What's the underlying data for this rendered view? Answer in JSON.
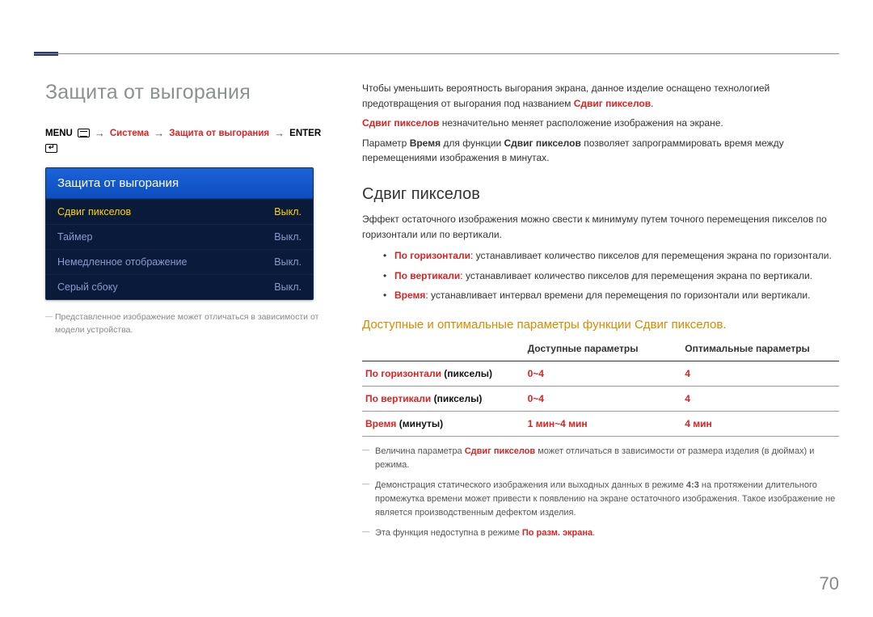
{
  "header": {
    "title": "Защита от выгорания"
  },
  "breadcrumb": {
    "menu": "MENU",
    "system": "Система",
    "protection": "Защита от выгорания",
    "enter": "ENTER"
  },
  "osd": {
    "title": "Защита от выгорания",
    "rows": [
      {
        "label": "Сдвиг пикселов",
        "value": "Выкл."
      },
      {
        "label": "Таймер",
        "value": "Выкл."
      },
      {
        "label": "Немедленное отображение",
        "value": "Выкл."
      },
      {
        "label": "Серый сбоку",
        "value": "Выкл."
      }
    ]
  },
  "left_note": "Представленное изображение может отличаться в зависимости от модели устройства.",
  "intro": {
    "p1a": "Чтобы уменьшить вероятность выгорания экрана, данное изделие оснащено технологией предотвращения от выгорания под названием ",
    "p1b": "Сдвиг пикселов",
    "p1c": ".",
    "p2a": "Сдвиг пикселов",
    "p2b": " незначительно меняет расположение изображения на экране.",
    "p3a": "Параметр ",
    "p3b": "Время",
    "p3c": " для функции ",
    "p3d": "Сдвиг пикселов",
    "p3e": " позволяет запрограммировать время между перемещениями изображения в минутах."
  },
  "section": {
    "title": "Сдвиг пикселов",
    "lead": "Эффект остаточного изображения можно свести к минимуму путем точного перемещения пикселов по горизонтали или по вертикали.",
    "bullets": [
      {
        "key": "По горизонтали",
        "text": ": устанавливает количество пикселов для перемещения экрана по горизонтали."
      },
      {
        "key": "По вертикали",
        "text": ": устанавливает количество пикселов для перемещения экрана по вертикали."
      },
      {
        "key": "Время",
        "text": ": устанавливает интервал времени для перемещения по горизонтали или вертикали."
      }
    ]
  },
  "table": {
    "subhead": "Доступные и оптимальные параметры функции Сдвиг пикселов.",
    "head": {
      "c1": "",
      "c2": "Доступные параметры",
      "c3": "Оптимальные параметры"
    },
    "rows": [
      {
        "label_red": "По горизонтали",
        "label_blk": " (пикселы)",
        "avail": "0~4",
        "opt": "4"
      },
      {
        "label_red": "По вертикали",
        "label_blk": " (пикселы)",
        "avail": "0~4",
        "opt": "4"
      },
      {
        "label_red": "Время",
        "label_blk": " (минуты)",
        "avail": "1 мин~4 мин",
        "opt": "4 мин"
      }
    ]
  },
  "notes": {
    "n1a": "Величина параметра ",
    "n1b": "Сдвиг пикселов",
    "n1c": " может отличаться в зависимости от размера изделия (в дюймах) и режима.",
    "n2a": "Демонстрация статического изображения или выходных данных в режиме ",
    "n2b": "4:3",
    "n2c": " на протяжении длительного промежутка времени может привести к появлению на экране остаточного изображения. Такое изображение не является производственным дефектом изделия.",
    "n3a": "Эта функция недоступна в режиме ",
    "n3b": "По разм. экрана",
    "n3c": "."
  },
  "page_number": "70",
  "chart_data": {
    "type": "table",
    "title": "Доступные и оптимальные параметры функции Сдвиг пикселов.",
    "columns": [
      "",
      "Доступные параметры",
      "Оптимальные параметры"
    ],
    "rows": [
      [
        "По горизонтали (пикселы)",
        "0~4",
        "4"
      ],
      [
        "По вертикали (пикселы)",
        "0~4",
        "4"
      ],
      [
        "Время (минуты)",
        "1 мин~4 мин",
        "4 мин"
      ]
    ]
  }
}
